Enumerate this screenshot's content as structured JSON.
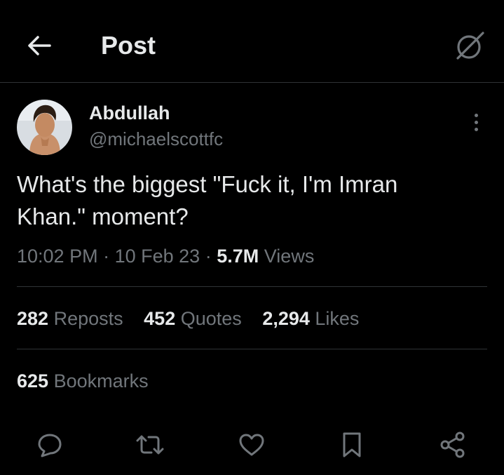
{
  "header": {
    "title": "Post",
    "back_icon": "arrow-left-icon",
    "grok_icon": "grok-icon"
  },
  "tweet": {
    "author_name": "Abdullah",
    "author_handle": "@michaelscottfc",
    "text": "What's the biggest \"Fuck it, I'm Imran\nKhan.\" moment?",
    "time": "10:02 PM",
    "date": "10 Feb 23",
    "separator": "·",
    "views_count": "5.7M",
    "views_label": "Views"
  },
  "stats": {
    "reposts_count": "282",
    "reposts_label": "Reposts",
    "quotes_count": "452",
    "quotes_label": "Quotes",
    "likes_count": "2,294",
    "likes_label": "Likes",
    "bookmarks_count": "625",
    "bookmarks_label": "Bookmarks"
  },
  "actions": [
    {
      "name": "reply",
      "icon": "reply-icon"
    },
    {
      "name": "repost",
      "icon": "repost-icon"
    },
    {
      "name": "like",
      "icon": "heart-icon"
    },
    {
      "name": "bookmark",
      "icon": "bookmark-icon"
    },
    {
      "name": "share",
      "icon": "share-icon"
    }
  ],
  "colors": {
    "background": "#000000",
    "primary_text": "#e7e9ea",
    "secondary_text": "#71767b",
    "divider": "#2f3336"
  }
}
